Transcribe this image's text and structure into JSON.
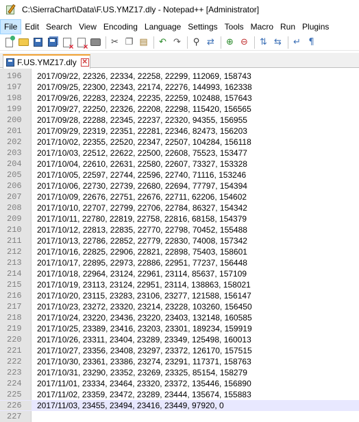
{
  "window": {
    "title": "C:\\SierraChart\\Data\\F.US.YMZ17.dly - Notepad++ [Administrator]",
    "icon": "notepad-plus-plus-icon"
  },
  "menu": [
    {
      "label": "File",
      "active": true
    },
    {
      "label": "Edit"
    },
    {
      "label": "Search"
    },
    {
      "label": "View"
    },
    {
      "label": "Encoding"
    },
    {
      "label": "Language"
    },
    {
      "label": "Settings"
    },
    {
      "label": "Tools"
    },
    {
      "label": "Macro"
    },
    {
      "label": "Run"
    },
    {
      "label": "Plugins"
    }
  ],
  "toolbar": [
    "new-file-icon",
    "open-folder-icon",
    "save-icon",
    "save-all-icon",
    "close-icon",
    "close-all-icon",
    "print-icon",
    "cut-icon",
    "copy-icon",
    "paste-icon",
    "undo-icon",
    "redo-icon",
    "find-icon",
    "replace-icon",
    "zoom-in-icon",
    "zoom-out-icon",
    "sync-vertical-icon",
    "sync-horizontal-icon",
    "word-wrap-icon",
    "show-all-characters-icon"
  ],
  "tab": {
    "label": "F.US.YMZ17.dly",
    "close_glyph": "✕",
    "accent_color": "#f0a030"
  },
  "editor": {
    "current_line": 226,
    "lines": [
      {
        "num": "196",
        "text": "2017/09/22, 22326, 22334, 22258, 22299, 112069, 158743"
      },
      {
        "num": "197",
        "text": "2017/09/25, 22300, 22343, 22174, 22276, 144993, 162338"
      },
      {
        "num": "198",
        "text": "2017/09/26, 22283, 22324, 22235, 22259, 102488, 157643"
      },
      {
        "num": "199",
        "text": "2017/09/27, 22250, 22326, 22208, 22298, 115420, 156565"
      },
      {
        "num": "200",
        "text": "2017/09/28, 22288, 22345, 22237, 22320, 94355, 156955"
      },
      {
        "num": "201",
        "text": "2017/09/29, 22319, 22351, 22281, 22346, 82473, 156203"
      },
      {
        "num": "202",
        "text": "2017/10/02, 22355, 22520, 22347, 22507, 104284, 156118"
      },
      {
        "num": "203",
        "text": "2017/10/03, 22512, 22622, 22500, 22608, 75523, 153477"
      },
      {
        "num": "204",
        "text": "2017/10/04, 22610, 22631, 22580, 22607, 73327, 153328"
      },
      {
        "num": "205",
        "text": "2017/10/05, 22597, 22744, 22596, 22740, 71116, 153246"
      },
      {
        "num": "206",
        "text": "2017/10/06, 22730, 22739, 22680, 22694, 77797, 154394"
      },
      {
        "num": "207",
        "text": "2017/10/09, 22676, 22751, 22676, 22711, 62206, 154602"
      },
      {
        "num": "208",
        "text": "2017/10/10, 22707, 22799, 22706, 22784, 86327, 154342"
      },
      {
        "num": "209",
        "text": "2017/10/11, 22780, 22819, 22758, 22816, 68158, 154379"
      },
      {
        "num": "210",
        "text": "2017/10/12, 22813, 22835, 22770, 22798, 70452, 155488"
      },
      {
        "num": "211",
        "text": "2017/10/13, 22786, 22852, 22779, 22830, 74008, 157342"
      },
      {
        "num": "212",
        "text": "2017/10/16, 22825, 22906, 22821, 22898, 75403, 158601"
      },
      {
        "num": "213",
        "text": "2017/10/17, 22895, 22973, 22886, 22951, 77237, 156448"
      },
      {
        "num": "214",
        "text": "2017/10/18, 22964, 23124, 22961, 23114, 85637, 157109"
      },
      {
        "num": "215",
        "text": "2017/10/19, 23113, 23124, 22951, 23114, 138863, 158021"
      },
      {
        "num": "216",
        "text": "2017/10/20, 23115, 23283, 23106, 23277, 121588, 156147"
      },
      {
        "num": "217",
        "text": "2017/10/23, 23272, 23320, 23214, 23228, 103260, 156450"
      },
      {
        "num": "218",
        "text": "2017/10/24, 23220, 23436, 23220, 23403, 132148, 160585"
      },
      {
        "num": "219",
        "text": "2017/10/25, 23389, 23416, 23203, 23301, 189234, 159919"
      },
      {
        "num": "220",
        "text": "2017/10/26, 23311, 23404, 23289, 23349, 125498, 160013"
      },
      {
        "num": "221",
        "text": "2017/10/27, 23356, 23408, 23297, 23372, 126170, 157515"
      },
      {
        "num": "222",
        "text": "2017/10/30, 23361, 23386, 23274, 23291, 117371, 158763"
      },
      {
        "num": "223",
        "text": "2017/10/31, 23290, 23352, 23269, 23325, 85154, 158279"
      },
      {
        "num": "224",
        "text": "2017/11/01, 23334, 23464, 23320, 23372, 135446, 156890"
      },
      {
        "num": "225",
        "text": "2017/11/02, 23359, 23472, 23289, 23444, 135674, 155883"
      },
      {
        "num": "226",
        "text": "2017/11/03, 23455, 23494, 23416, 23449, 97920, 0"
      },
      {
        "num": "227",
        "text": ""
      }
    ]
  }
}
